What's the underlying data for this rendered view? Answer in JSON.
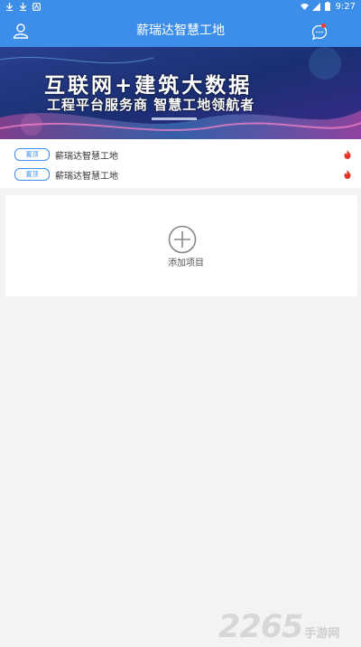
{
  "status_bar": {
    "time": "9:27",
    "left_icons": [
      "download-icon",
      "download-icon",
      "app-icon"
    ],
    "right_icons": [
      "wifi-icon",
      "signal-icon",
      "battery-icon"
    ]
  },
  "header": {
    "title": "薪瑞达智慧工地",
    "left_icon": "user-icon",
    "right_icon": "message-icon",
    "color": "#3d8ee8"
  },
  "banner": {
    "line1": "互联网+建筑大数据",
    "line2": "工程平台服务商 智慧工地领航者"
  },
  "projects": [
    {
      "tag": "置顶",
      "name": "薪瑞达智慧工地",
      "icon": "fire-icon"
    },
    {
      "tag": "置顶",
      "name": "薪瑞达智慧工地",
      "icon": "fire-icon"
    }
  ],
  "add_project": {
    "label": "添加项目",
    "icon": "plus-circle-icon"
  },
  "watermark": {
    "number": "2265",
    "suffix": "手游网"
  },
  "colors": {
    "primary": "#3d8ee8",
    "fire": "#e3372b",
    "background": "#f3f3f3"
  }
}
